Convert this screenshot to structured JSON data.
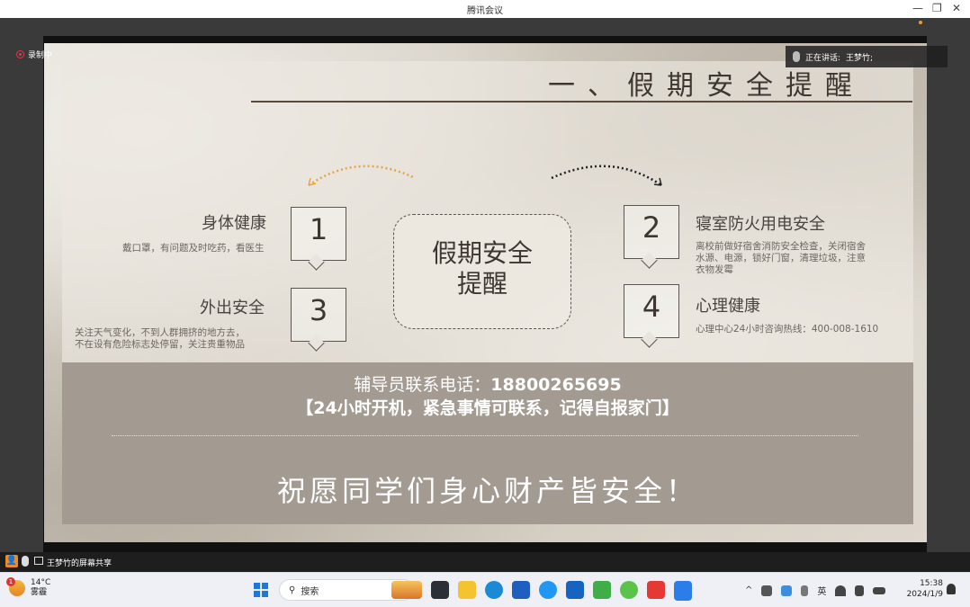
{
  "window": {
    "title": "腾讯会议",
    "minimize": "—",
    "restore": "❐",
    "close": "✕"
  },
  "meeting": {
    "recording_label": "录制中",
    "speaking_label": "正在讲话:",
    "speaker_name": "王梦竹;",
    "share_label": "王梦竹的屏幕共享",
    "accent_color": "#f08a24"
  },
  "slide": {
    "title": "一、假期安全提醒",
    "center": [
      "假期安全",
      "提醒"
    ],
    "items": [
      {
        "num": "1",
        "heading": "身体健康",
        "desc": [
          "戴口罩，有问题及时吃药，看医生"
        ]
      },
      {
        "num": "2",
        "heading": "寝室防火用电安全",
        "desc": [
          "离校前做好宿舍消防安全检查，关闭宿舍",
          "水源、电源，锁好门窗，清理垃圾，注意",
          "衣物发霉"
        ]
      },
      {
        "num": "3",
        "heading": "外出安全",
        "desc": [
          "关注天气变化，不到人群拥挤的地方去，",
          "不在设有危险标志处停留，关注贵重物品"
        ]
      },
      {
        "num": "4",
        "heading": "心理健康",
        "desc": [
          "心理中心24小时咨询热线：400-008-1610"
        ]
      }
    ],
    "banner": {
      "contact_label": "辅导员联系电话：",
      "contact_number": "18800265695",
      "note": "【24小时开机，紧急事情可联系，记得自报家门】",
      "wish": "祝愿同学们身心财产皆安全！"
    }
  },
  "taskbar": {
    "weather_temp": "14°C",
    "weather_desc": "雾霾",
    "weather_badge": "1",
    "search_placeholder": "搜索",
    "ime": "英",
    "time": "15:38",
    "date": "2024/1/9"
  }
}
